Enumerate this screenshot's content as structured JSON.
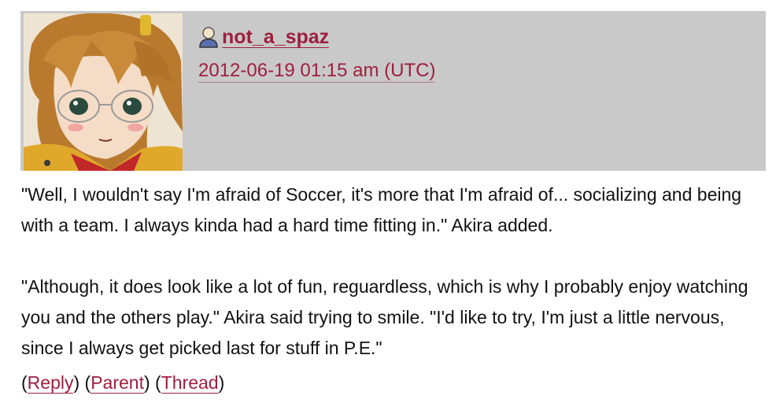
{
  "comment": {
    "username": "not_a_spaz",
    "timestamp": "2012-06-19 01:15 am (UTC)",
    "paragraphs": [
      "\"Well, I wouldn't say I'm afraid of Soccer, it's more that I'm afraid of... socializing and being with a team. I always kinda had a hard time fitting in.\" Akira added.",
      "\"Although, it does look like a lot of fun, reguardless, which is why I probably enjoy watching you and the others play.\" Akira said trying to smile. \"I'd like to try, I'm just a little nervous, since I always get picked last for stuff in P.E.\""
    ]
  },
  "actions": {
    "reply_label": "Reply",
    "parent_label": "Parent",
    "thread_label": "Thread",
    "open_paren": "(",
    "close_paren": ")",
    "separator": " "
  },
  "icons": {
    "avatar": "anime-character-avatar",
    "user": "user-icon"
  },
  "colors": {
    "header_bg": "#c9c9c9",
    "link": "#9e1f3f",
    "text": "#111111"
  }
}
